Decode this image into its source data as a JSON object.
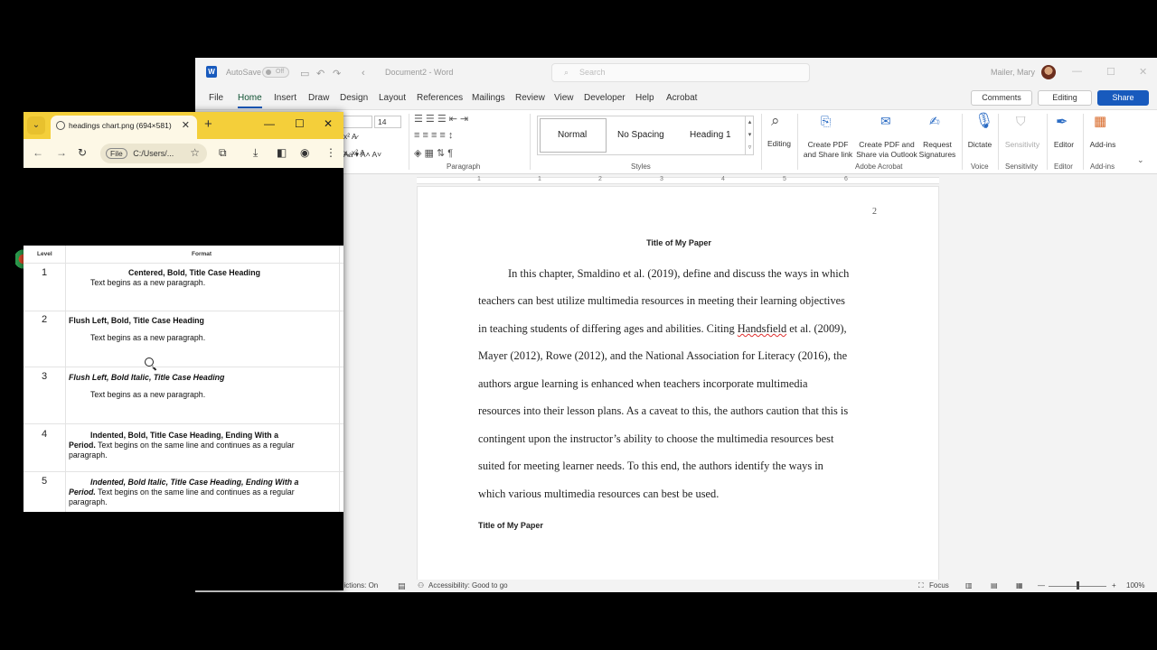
{
  "word": {
    "autosave_label": "AutoSave",
    "autosave_state": "Off",
    "doc_name": "Document2 - Word",
    "search_placeholder": "Search",
    "user_name": "Mailer, Mary",
    "menu": [
      "File",
      "Home",
      "Insert",
      "Draw",
      "Design",
      "Layout",
      "References",
      "Mailings",
      "Review",
      "View",
      "Developer",
      "Help",
      "Acrobat"
    ],
    "active_menu": "Home",
    "comments_label": "Comments",
    "editing_label": "Editing",
    "share_label": "Share",
    "font_size": "14",
    "styles": [
      "Normal",
      "No Spacing",
      "Heading 1"
    ],
    "group_labels": {
      "paragraph": "Paragraph",
      "styles": "Styles",
      "adobe": "Adobe Acrobat",
      "voice": "Voice",
      "sensitivity": "Sensitivity",
      "editor": "Editor",
      "addins": "Add-ins"
    },
    "ribbon_buttons": {
      "editing": "Editing",
      "create_pdf_1": "Create PDF",
      "create_pdf_2": "and Share link",
      "create_pdf_outlook_1": "Create PDF and",
      "create_pdf_outlook_2": "Share via Outlook",
      "request_sig_1": "Request",
      "request_sig_2": "Signatures",
      "dictate": "Dictate",
      "sensitivity": "Sensitivity",
      "editor": "Editor",
      "addins": "Add-ins"
    },
    "ruler_numbers": [
      "1",
      "1",
      "2",
      "3",
      "4",
      "5",
      "6"
    ],
    "page": {
      "page_number": "2",
      "title": "Title of My Paper",
      "lines": [
        "In this chapter, Smaldino et al. (2019), define and discuss the ways in which",
        "teachers can best utilize multimedia resources in meeting their learning objectives",
        "in teaching students of differing ages and abilities. Citing",
        "Handsfield",
        "et al. (2009),",
        "Mayer (2012), Rowe (2012), and the National Association for Literacy (2016), the",
        "authors argue learning is enhanced when teachers incorporate multimedia",
        "resources into their lesson plans. As a caveat to this, the authors caution that this is",
        "contingent upon the instructor’s ability to choose the multimedia resources best",
        "suited for meeting learner needs. To this end, the authors identify the ways in",
        "which various multimedia resources can best be used."
      ],
      "subheading": "Title of My Paper"
    },
    "status": {
      "predictions": "dictions: On",
      "accessibility": "Accessibility: Good to go",
      "focus": "Focus",
      "zoom": "100%"
    }
  },
  "browser": {
    "tab_title": "headings chart.png (694×581)",
    "url_chip": "File",
    "url": "C:/Users/...",
    "chart": {
      "headers": [
        "Level",
        "Format"
      ],
      "rows": [
        {
          "level": "1",
          "heading": "Centered, Bold, Title Case Heading",
          "body": "Text begins as a new paragraph."
        },
        {
          "level": "2",
          "heading": "Flush Left, Bold, Title Case Heading",
          "body": "Text begins as a new paragraph."
        },
        {
          "level": "3",
          "heading": "Flush Left, Bold Italic, Title Case Heading",
          "body": "Text begins as a new paragraph."
        },
        {
          "level": "4",
          "heading_a": "Indented, Bold, Title Case Heading, Ending With a",
          "heading_b": "Period.",
          "body_a": " Text begins on the same line and continues as a regular",
          "body_b": "paragraph."
        },
        {
          "level": "5",
          "heading_a": "Indented, Bold Italic, Title Case Heading, Ending With a",
          "heading_b": "Period.",
          "body_a": " Text begins on the same line and continues as a regular",
          "body_b": "paragraph."
        }
      ]
    }
  }
}
